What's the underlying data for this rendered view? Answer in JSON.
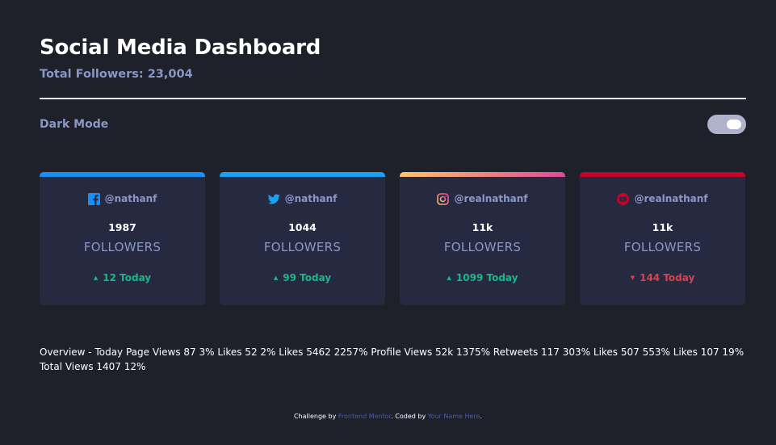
{
  "header": {
    "title": "Social Media Dashboard",
    "total_followers": "Total Followers: 23,004"
  },
  "mode": {
    "label": "Dark Mode",
    "enabled": true
  },
  "cards": [
    {
      "platform": "facebook",
      "icon": "facebook-icon",
      "handle": "@nathanf",
      "count": "1987",
      "label": "FOLLOWERS",
      "today": "12 Today",
      "trend": "up"
    },
    {
      "platform": "twitter",
      "icon": "twitter-icon",
      "handle": "@nathanf",
      "count": "1044",
      "label": "FOLLOWERS",
      "today": "99 Today",
      "trend": "up"
    },
    {
      "platform": "instagram",
      "icon": "instagram-icon",
      "handle": "@realnathanf",
      "count": "11k",
      "label": "FOLLOWERS",
      "today": "1099 Today",
      "trend": "up"
    },
    {
      "platform": "youtube",
      "icon": "youtube-icon",
      "handle": "@realnathanf",
      "count": "11k",
      "label": "FOLLOWERS",
      "today": "144 Today",
      "trend": "down"
    }
  ],
  "overview": {
    "text": "Overview - Today Page Views 87 3% Likes 52 2% Likes 5462 2257% Profile Views 52k 1375% Retweets 117 303% Likes 507 553% Likes 107 19% Total Views 1407 12%"
  },
  "footer": {
    "prefix": "Challenge by ",
    "challenge_link": "Frontend Mentor",
    "middle": ". Coded by ",
    "author_link": "Your Name Here",
    "suffix": "."
  },
  "colors": {
    "background": "#1e202a",
    "card": "#252a41",
    "muted_text": "#8b97c6",
    "up": "#1eb589",
    "down": "#dc414c",
    "facebook": "#198ff5",
    "twitter": "#1ca0f2",
    "instagram_start": "#fdc468",
    "instagram_end": "#df4996",
    "youtube": "#c4032b"
  }
}
